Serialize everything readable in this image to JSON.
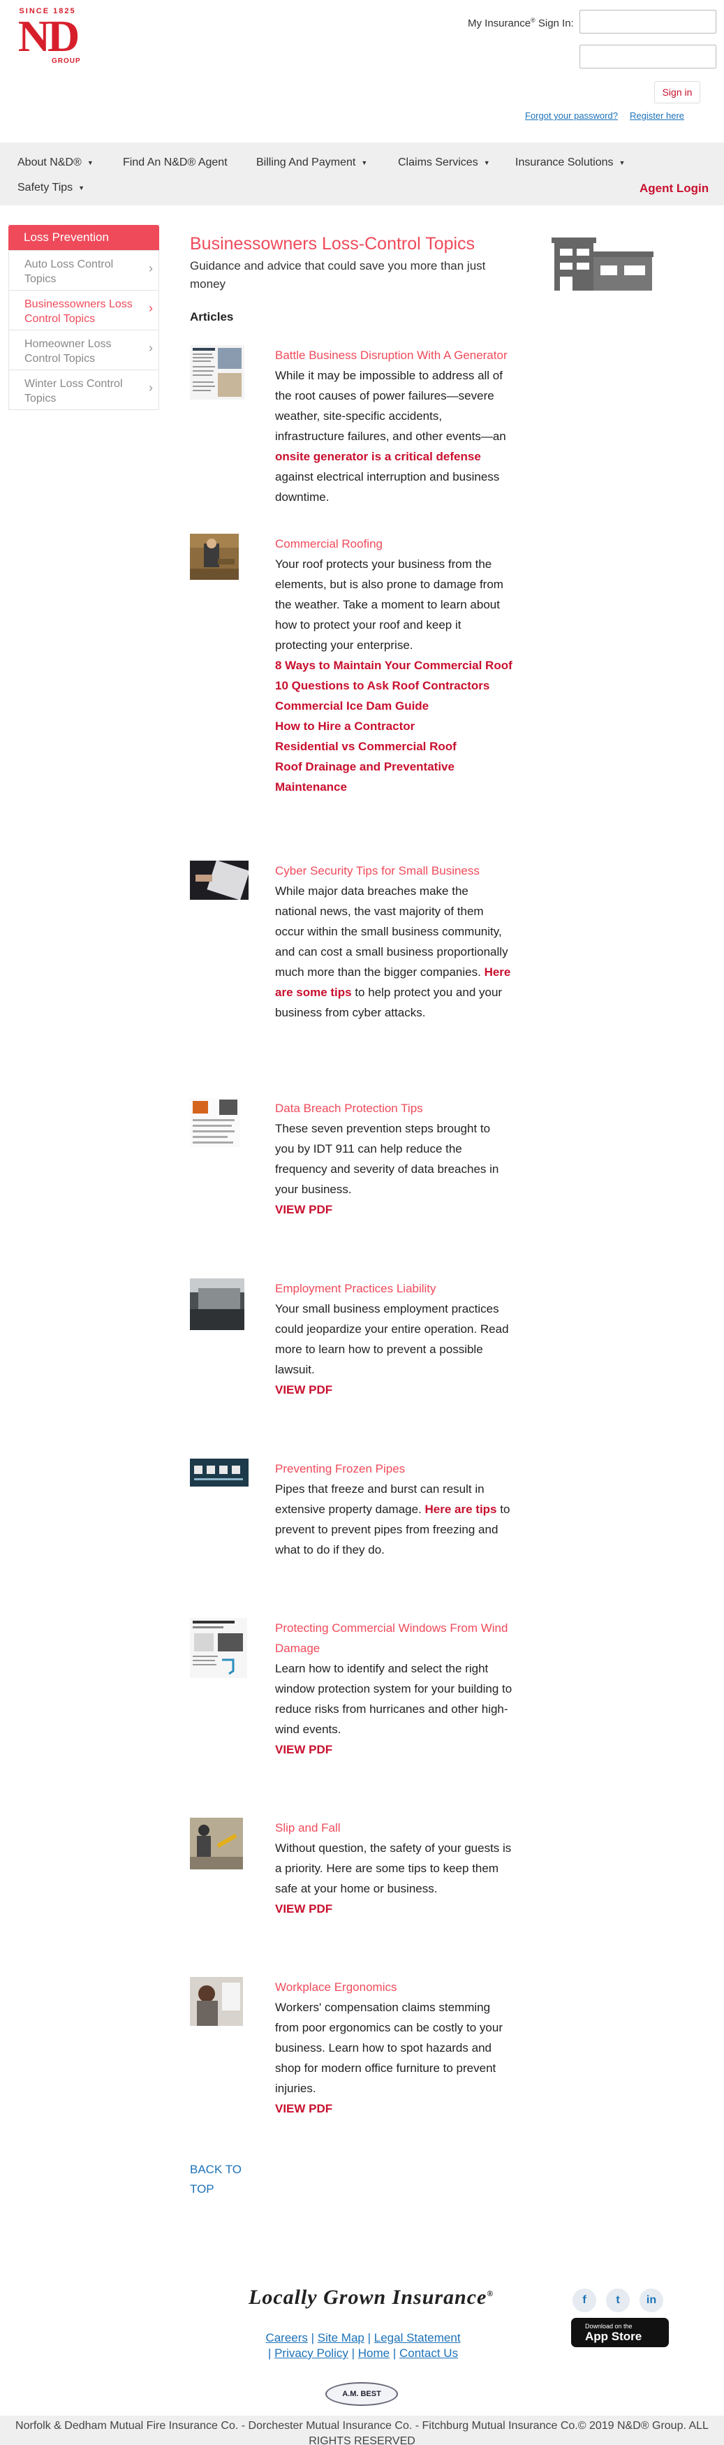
{
  "header": {
    "logo_since": "SINCE 1825",
    "logo_mark": "ND",
    "logo_group": "GROUP",
    "signin_prefix": "My Insurance",
    "signin_reg": "®",
    "signin_suffix": " Sign In:",
    "signin_button": "Sign in",
    "forgot_password": "Forgot your password?",
    "register": "Register here"
  },
  "nav": {
    "items": [
      {
        "label": "About N&D®"
      },
      {
        "label": "Find An N&D® Agent"
      },
      {
        "label": "Billing And Payment"
      },
      {
        "label": "Claims Services"
      },
      {
        "label": "Insurance Solutions"
      },
      {
        "label": "Safety Tips"
      }
    ],
    "agent_login": "Agent Login"
  },
  "sidebar": {
    "heading": "Loss Prevention",
    "items": [
      {
        "label": "Auto Loss Control Topics"
      },
      {
        "label": "Businessowners Loss Control Topics"
      },
      {
        "label": "Homeowner Loss Control Topics"
      },
      {
        "label": "Winter Loss Control Topics"
      }
    ]
  },
  "main": {
    "title": "Businessowners Loss-Control Topics",
    "subtitle": "Guidance and advice that could save you more than just money",
    "articles_heading": "Articles",
    "articles": [
      {
        "title": "Battle Business Disruption With A Generator",
        "text_before": "While it may be impossible to address all of the root causes of power failures—severe weather, site-specific accidents, infrastructure failures, and other events—an ",
        "link": "onsite generator is a critical defense",
        "text_after": " against electrical interruption and business downtime."
      },
      {
        "title": "Commercial Roofing",
        "text": "Your roof protects your business from the elements, but is also prone to damage from the weather. Take a moment to learn about how to protect your roof and keep it protecting your enterprise.",
        "links": [
          "8 Ways to Maintain Your Commercial Roof",
          "10 Questions to Ask Roof Contractors",
          "Commercial Ice Dam Guide",
          "How to Hire a Contractor",
          "Residential vs Commercial Roof",
          "Roof Drainage and Preventative Maintenance"
        ]
      },
      {
        "title": "Cyber Security Tips for Small Business",
        "text_before": "While major data breaches make the national news, the vast majority of them occur within the small business community, and can cost a small business proportionally much more than the bigger companies. ",
        "link": "Here are some tips",
        "text_after": " to help protect you and your business from cyber attacks."
      },
      {
        "title": "Data Breach Protection Tips",
        "text": "These seven prevention steps brought to you by IDT 911 can help reduce the frequency and severity of data breaches in your business.",
        "link": "VIEW PDF"
      },
      {
        "title": "Employment Practices Liability",
        "text": "Your small business employment practices could jeopardize your entire operation. Read more to learn how to prevent a possible lawsuit.",
        "link": "VIEW PDF"
      },
      {
        "title": "Preventing Frozen Pipes",
        "text_before": "Pipes that freeze and burst can result in extensive property damage. ",
        "link": "Here are tips",
        "text_after": " to prevent to prevent pipes from freezing and what to do if they do."
      },
      {
        "title": "Protecting Commercial Windows From Wind Damage",
        "text": "Learn how to identify and select the right window protection system for your building to reduce risks from hurricanes and other high-wind events.",
        "link": "VIEW PDF"
      },
      {
        "title": "Slip and Fall",
        "text": "Without question, the safety of your guests is a priority. Here are some tips to keep them safe at your home or business.",
        "link": "VIEW PDF"
      },
      {
        "title": "Workplace Ergonomics",
        "text": "Workers' compensation claims stemming from poor ergonomics can be costly to your business. Learn how to spot hazards and shop for modern office furniture to prevent injuries.",
        "link": "VIEW PDF"
      }
    ],
    "back_to_top": "BACK TO TOP"
  },
  "footer": {
    "tagline": "Locally Grown Insurance",
    "tagline_mark": "®",
    "links": [
      "Careers",
      "Site Map",
      "Legal Statement",
      "Privacy Policy",
      "Home",
      "Contact Us"
    ],
    "social": [
      {
        "icon": "facebook-icon",
        "glyph": "f"
      },
      {
        "icon": "twitter-icon",
        "glyph": "t"
      },
      {
        "icon": "linkedin-icon",
        "glyph": "in"
      }
    ],
    "appstore_small": "Download on the",
    "appstore_big": "App Store",
    "ambest": "A.M. BEST",
    "copyright_text": "Norfolk & Dedham Mutual Fire Insurance Co. - Dorchester Mutual Insurance Co. - Fitchburg Mutual Insurance Co.© 2019 N&D® Group. ALL RIGHTS RESERVED"
  },
  "colors": {
    "brand_red": "#d71f2b",
    "accent_pink": "#ef4a5a",
    "link_blue": "#1d72b8",
    "dark_red": "#c8102e"
  }
}
